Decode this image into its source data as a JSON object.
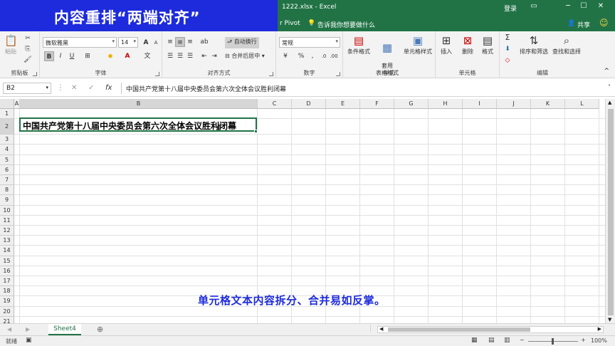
{
  "overlay": {
    "title": "内容重排“两端对齐”",
    "subtitle": "单元格文本内容拆分、合并易如反掌。"
  },
  "titlebar": {
    "doc_title": "1222.xlsx  -  Excel",
    "login": "登录"
  },
  "tabs": {
    "partial_tab": "r Pivot",
    "tellme": "告诉我你想要做什么",
    "share": "共享"
  },
  "ribbon": {
    "clipboard": {
      "label": "剪贴板",
      "paste": "粘贴"
    },
    "font": {
      "label": "字体",
      "font_name": "微软雅黑",
      "font_size": "14"
    },
    "alignment": {
      "label": "对齐方式",
      "wrap": "自动换行",
      "merge": "合并后居中"
    },
    "number": {
      "label": "数字",
      "format": "常规",
      "percent": "%",
      "comma": ","
    },
    "styles": {
      "label": "样式",
      "conditional": "条件格式",
      "table": "套用\n表格格式",
      "cell_styles": "单元格样式"
    },
    "cells": {
      "label": "单元格",
      "insert": "插入",
      "delete": "删除",
      "format": "格式"
    },
    "editing": {
      "label": "编辑",
      "sort": "排序和筛选",
      "find": "查找和选择"
    }
  },
  "formula_bar": {
    "name_box": "B2",
    "fx": "fx",
    "content": "中国共产党第十八届中央委员会第六次全体会议胜利闭幕"
  },
  "grid": {
    "columns": [
      "A",
      "B",
      "C",
      "D",
      "E",
      "F",
      "G",
      "H",
      "I",
      "J",
      "K",
      "L"
    ],
    "rows": [
      "1",
      "2",
      "3",
      "4",
      "5",
      "6",
      "7",
      "8",
      "9",
      "10",
      "11",
      "12",
      "13",
      "14",
      "15",
      "16",
      "17",
      "18",
      "19",
      "20",
      "21"
    ],
    "cell_B2": "中国共产党第十八届中央委员会第六次全体会议胜利闭幕"
  },
  "sheet": {
    "tab": "Sheet4",
    "add": "⊕"
  },
  "status": {
    "ready": "就绪",
    "zoom": "100%"
  }
}
